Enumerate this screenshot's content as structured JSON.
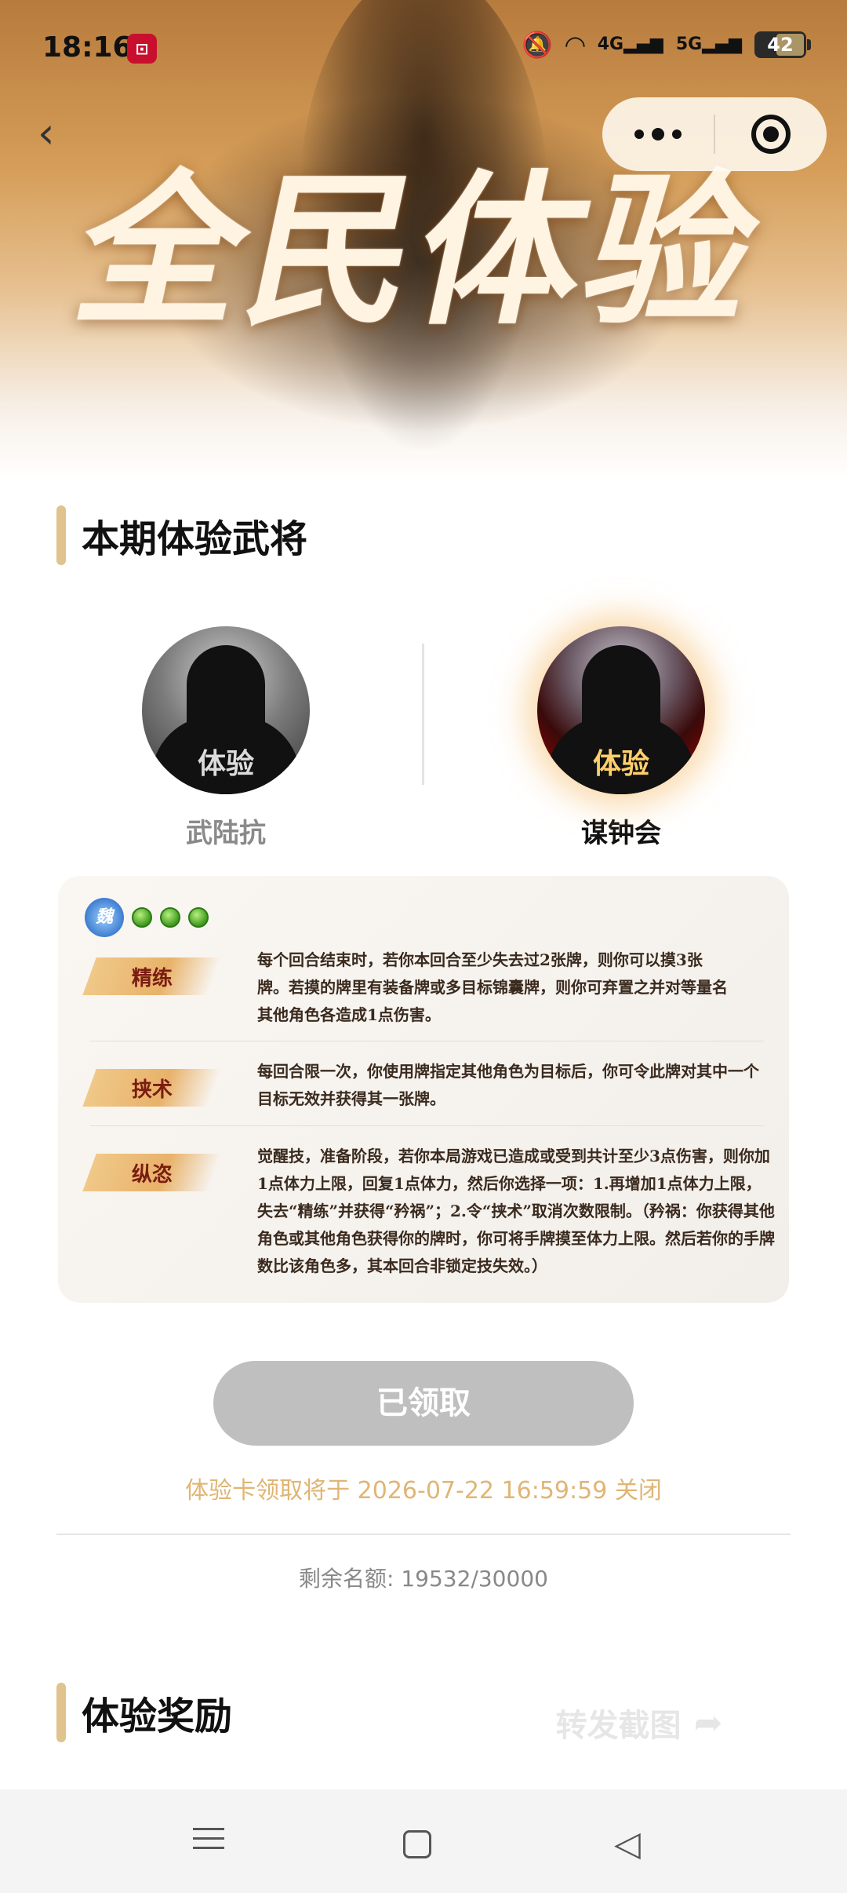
{
  "status_bar": {
    "time": "18:16",
    "battery": "42",
    "net1": "4G",
    "net2": "5G"
  },
  "banner": {
    "title": "全民体验"
  },
  "sections": {
    "trial_generals": "本期体验武将",
    "rewards": "体验奖励"
  },
  "generals": [
    {
      "name": "武陆抗",
      "badge": "体验",
      "selected": false
    },
    {
      "name": "谋钟会",
      "badge": "体验",
      "selected": true
    }
  ],
  "skill_card": {
    "kingdom_glyph": "魏",
    "hp": 3,
    "skills": [
      {
        "name": "精练",
        "description": "每个回合结束时，若你本回合至少失去过2张牌，则你可以摸3张牌。若摸的牌里有装备牌或多目标锦囊牌，则你可弃置之并对等量名其他角色各造成1点伤害。"
      },
      {
        "name": "挟术",
        "description": "每回合限一次，你使用牌指定其他角色为目标后，你可令此牌对其中一个目标无效并获得其一张牌。"
      },
      {
        "name": "纵恣",
        "description": "觉醒技，准备阶段，若你本局游戏已造成或受到共计至少3点伤害，则你加1点体力上限，回复1点体力，然后你选择一项：1.再增加1点体力上限，失去“精练”并获得“矜祸”；2.令“挟术”取消次数限制。（矜祸：你获得其他角色或其他角色获得你的牌时，你可将手牌摸至体力上限。然后若你的手牌数比该角色多，其本回合非锁定技失效。）"
      }
    ]
  },
  "claim": {
    "button_label": "已领取",
    "deadline_text": "体验卡领取将于 2026-07-22 16:59:59 关闭",
    "quota_text": "剩余名额: 19532/30000"
  },
  "share": {
    "label": "转发截图"
  },
  "colors": {
    "accent_gold": "#e0c38d",
    "deadline_text": "#e0b574",
    "disabled_button": "#bfbfbf"
  }
}
